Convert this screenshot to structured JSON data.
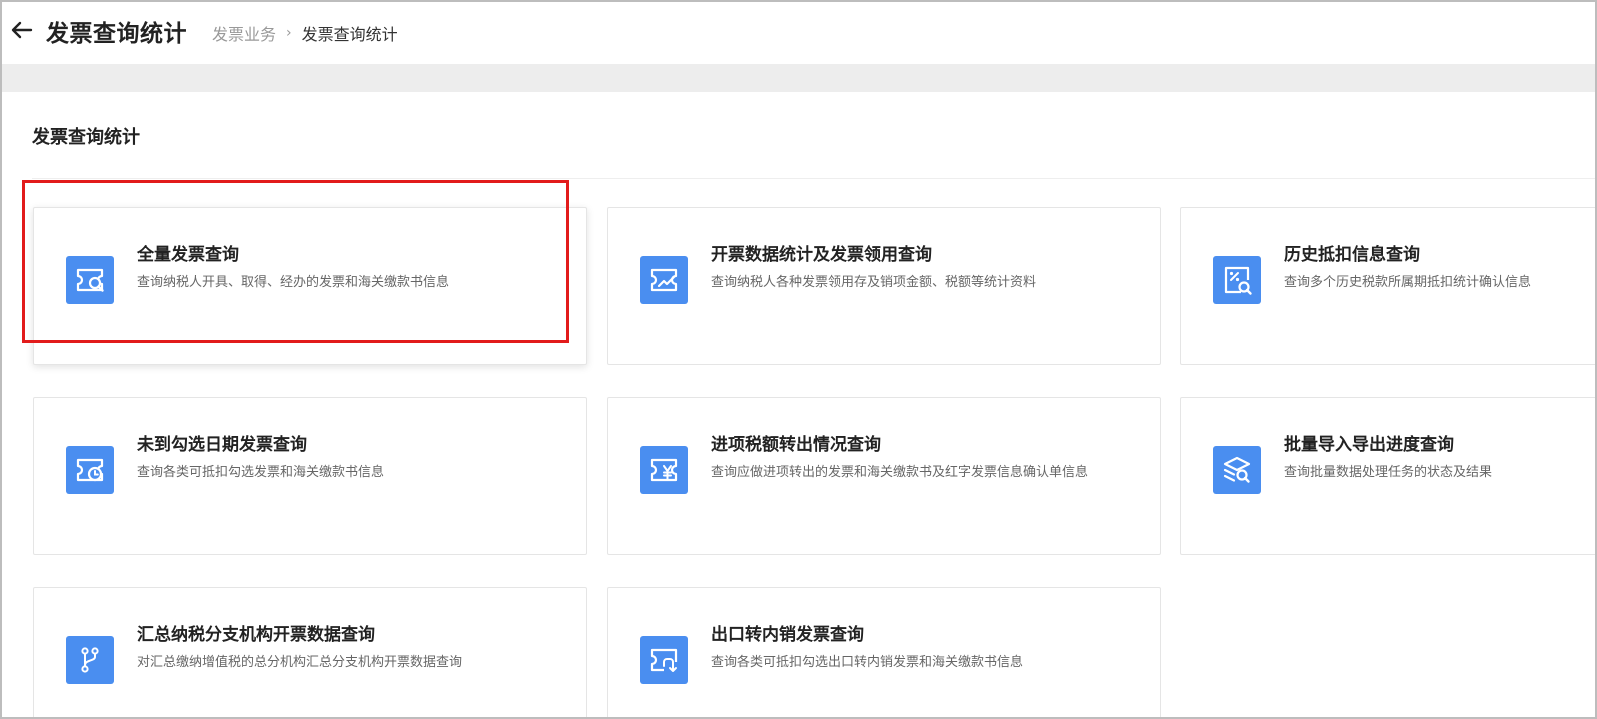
{
  "header": {
    "title": "发票查询统计",
    "breadcrumb": [
      "发票业务",
      "发票查询统计"
    ]
  },
  "section": {
    "title": "发票查询统计"
  },
  "cards": [
    {
      "title": "全量发票查询",
      "desc": "查询纳税人开具、取得、经办的发票和海关缴款书信息",
      "icon": "invoice-search-icon"
    },
    {
      "title": "开票数据统计及发票领用查询",
      "desc": "查询纳税人各种发票领用存及销项金额、税额等统计资料",
      "icon": "invoice-trend-icon"
    },
    {
      "title": "历史抵扣信息查询",
      "desc": "查询多个历史税款所属期抵扣统计确认信息",
      "icon": "percent-search-icon"
    },
    {
      "title": "未到勾选日期发票查询",
      "desc": "查询各类可抵扣勾选发票和海关缴款书信息",
      "icon": "invoice-clock-icon"
    },
    {
      "title": "进项税额转出情况查询",
      "desc": "查询应做进项转出的发票和海关缴款书及红字发票信息确认单信息",
      "icon": "invoice-yen-icon"
    },
    {
      "title": "批量导入导出进度查询",
      "desc": "查询批量数据处理任务的状态及结果",
      "icon": "batch-search-icon"
    },
    {
      "title": "汇总纳税分支机构开票数据查询",
      "desc": "对汇总缴纳增值税的总分机构汇总分支机构开票数据查询",
      "icon": "branch-icon"
    },
    {
      "title": "出口转内销发票查询",
      "desc": "查询各类可抵扣勾选出口转内销发票和海关缴款书信息",
      "icon": "invoice-return-icon"
    }
  ],
  "colors": {
    "accent": "#4a8ef0",
    "highlight": "#e21b1b"
  }
}
